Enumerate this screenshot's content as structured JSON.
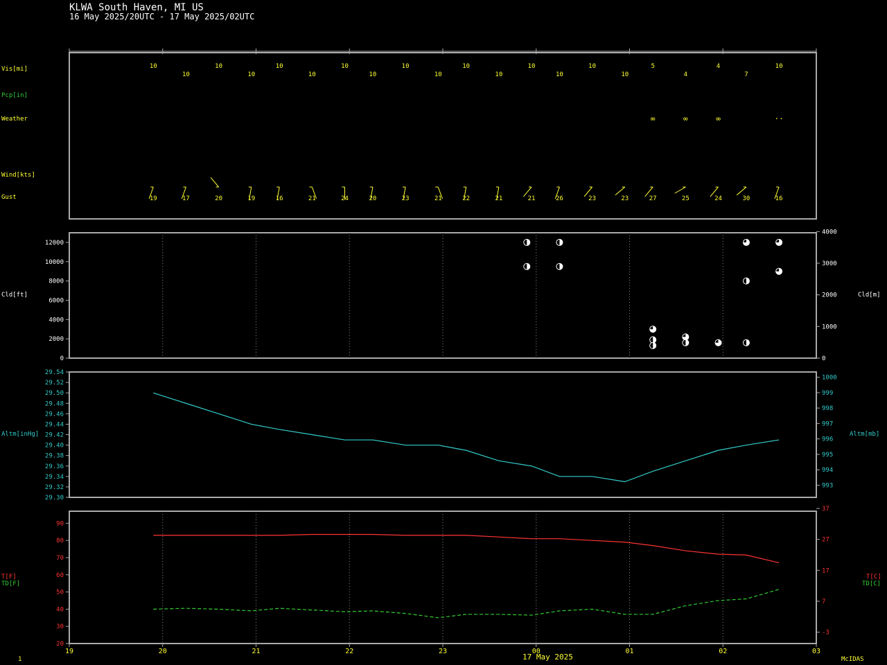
{
  "header": {
    "title": "KLWA  South Haven, MI US",
    "subtitle": "16 May 2025/20UTC - 17 May 2025/02UTC"
  },
  "footer": {
    "left": "1",
    "date": "17 May 2025",
    "brand": "McIDAS"
  },
  "labels": {
    "vis": "Vis[mi]",
    "pcp": "Pcp[in]",
    "weather": "Weather",
    "wind": "Wind[kts]",
    "gust": "Gust",
    "cld_ft": "Cld[ft]",
    "cld_m": "Cld[m]",
    "altm_inhg": "Altm[inHg]",
    "altm_mb": "Altm[mb]",
    "t_f": "T[F]",
    "td_f": "TD[F]",
    "t_c": "T[C]",
    "td_c": "TD[C]"
  },
  "colors": {
    "yellow": "#ffff33",
    "cyan": "#33cccc",
    "green": "#33cc33",
    "red": "#ff3333",
    "white": "#ffffff",
    "frame": "#aaaaaa"
  },
  "chart_data": [
    {
      "type": "table",
      "name": "surface_obs",
      "x": [
        19.9,
        20.25,
        20.6,
        20.95,
        21.25,
        21.6,
        21.95,
        22.25,
        22.6,
        22.95,
        23.25,
        23.6,
        23.95,
        24.25,
        24.6,
        24.95,
        25.25,
        25.6,
        25.95,
        26.25,
        26.6
      ],
      "vis": [
        "10",
        "10",
        "10",
        "10",
        "10",
        "10",
        "10",
        "10",
        "10",
        "10",
        "10",
        "10",
        "10",
        "10",
        "10",
        "10",
        "5",
        "4",
        "4",
        "7",
        "10"
      ],
      "weather": [
        "",
        "",
        "",
        "",
        "",
        "",
        "",
        "",
        "",
        "",
        "",
        "",
        "",
        "",
        "",
        "",
        "∞",
        "∞",
        "∞",
        "",
        "··"
      ],
      "wind_dir_deg": [
        200,
        200,
        320,
        190,
        190,
        160,
        180,
        190,
        190,
        160,
        190,
        190,
        220,
        200,
        220,
        230,
        220,
        240,
        220,
        230,
        200
      ],
      "gust": [
        "19",
        "17",
        "20",
        "19",
        "16",
        "21",
        "24",
        "20",
        "23",
        "21",
        "22",
        "21",
        "21",
        "26",
        "23",
        "23",
        "27",
        "25",
        "24",
        "30",
        "16"
      ],
      "x_ticks": [
        19,
        20,
        21,
        22,
        23,
        24,
        25,
        26,
        27
      ]
    },
    {
      "type": "scatter",
      "name": "cloud_layers",
      "ylabel": "Cld[ft]",
      "ylim": [
        0,
        13000
      ],
      "yticks": [
        0,
        2000,
        4000,
        6000,
        8000,
        10000,
        12000
      ],
      "y2ticks": [
        0,
        1000,
        2000,
        3000,
        4000
      ],
      "points": [
        {
          "x": 23.9,
          "y": 12000,
          "cover": "half"
        },
        {
          "x": 23.9,
          "y": 9500,
          "cover": "half"
        },
        {
          "x": 24.25,
          "y": 12000,
          "cover": "half"
        },
        {
          "x": 24.25,
          "y": 9500,
          "cover": "half"
        },
        {
          "x": 25.25,
          "y": 3000,
          "cover": "broken"
        },
        {
          "x": 25.25,
          "y": 1900,
          "cover": "half"
        },
        {
          "x": 25.25,
          "y": 1300,
          "cover": "half"
        },
        {
          "x": 25.6,
          "y": 2200,
          "cover": "broken"
        },
        {
          "x": 25.6,
          "y": 1600,
          "cover": "half"
        },
        {
          "x": 25.95,
          "y": 1600,
          "cover": "broken"
        },
        {
          "x": 26.25,
          "y": 12000,
          "cover": "broken"
        },
        {
          "x": 26.25,
          "y": 8000,
          "cover": "half"
        },
        {
          "x": 26.25,
          "y": 1600,
          "cover": "half"
        },
        {
          "x": 26.6,
          "y": 12000,
          "cover": "broken"
        },
        {
          "x": 26.6,
          "y": 9000,
          "cover": "broken"
        }
      ]
    },
    {
      "type": "line",
      "name": "altimeter",
      "ylabel": "Altm[inHg]",
      "ylim": [
        29.3,
        29.54
      ],
      "yticks": [
        29.3,
        29.32,
        29.34,
        29.36,
        29.38,
        29.4,
        29.42,
        29.44,
        29.46,
        29.48,
        29.5,
        29.52,
        29.54
      ],
      "y2ticks": [
        993,
        994,
        995,
        996,
        997,
        998,
        999,
        1000
      ],
      "x": [
        19.9,
        20.25,
        20.6,
        20.95,
        21.25,
        21.6,
        21.95,
        22.25,
        22.6,
        22.95,
        23.25,
        23.6,
        23.95,
        24.25,
        24.6,
        24.95,
        25.25,
        25.6,
        25.95,
        26.25,
        26.6
      ],
      "values": [
        29.5,
        29.48,
        29.46,
        29.44,
        29.43,
        29.42,
        29.41,
        29.41,
        29.4,
        29.4,
        29.39,
        29.37,
        29.36,
        29.34,
        29.34,
        29.33,
        29.35,
        29.37,
        29.39,
        29.4,
        29.41
      ]
    },
    {
      "type": "line",
      "name": "temperature",
      "ylim": [
        20,
        97
      ],
      "yticks": [
        20,
        30,
        40,
        50,
        60,
        70,
        80,
        90
      ],
      "y2ticks": [
        -3,
        7,
        17,
        27,
        37
      ],
      "x": [
        19.9,
        20.25,
        20.6,
        20.95,
        21.25,
        21.6,
        21.95,
        22.25,
        22.6,
        22.95,
        23.25,
        23.6,
        23.95,
        24.25,
        24.6,
        24.95,
        25.25,
        25.6,
        25.95,
        26.25,
        26.6
      ],
      "series": [
        {
          "name": "T[F]",
          "values": [
            83,
            83,
            83,
            83,
            83,
            83.5,
            83.5,
            83.5,
            83,
            83,
            83,
            82,
            81,
            81,
            80,
            79,
            77,
            74,
            72,
            71.5,
            67
          ]
        },
        {
          "name": "TD[F]",
          "values": [
            40,
            40.5,
            40,
            39,
            40.5,
            39.5,
            38.5,
            39,
            37.5,
            35,
            37,
            37,
            36.5,
            39,
            40,
            37,
            37,
            42,
            45,
            46,
            51.5
          ]
        }
      ],
      "xticks": [
        19,
        20,
        21,
        22,
        23,
        24,
        25,
        26,
        27
      ],
      "xtick_labels": [
        "19",
        "20",
        "21",
        "22",
        "23",
        "00",
        "01",
        "02",
        "03"
      ]
    }
  ]
}
